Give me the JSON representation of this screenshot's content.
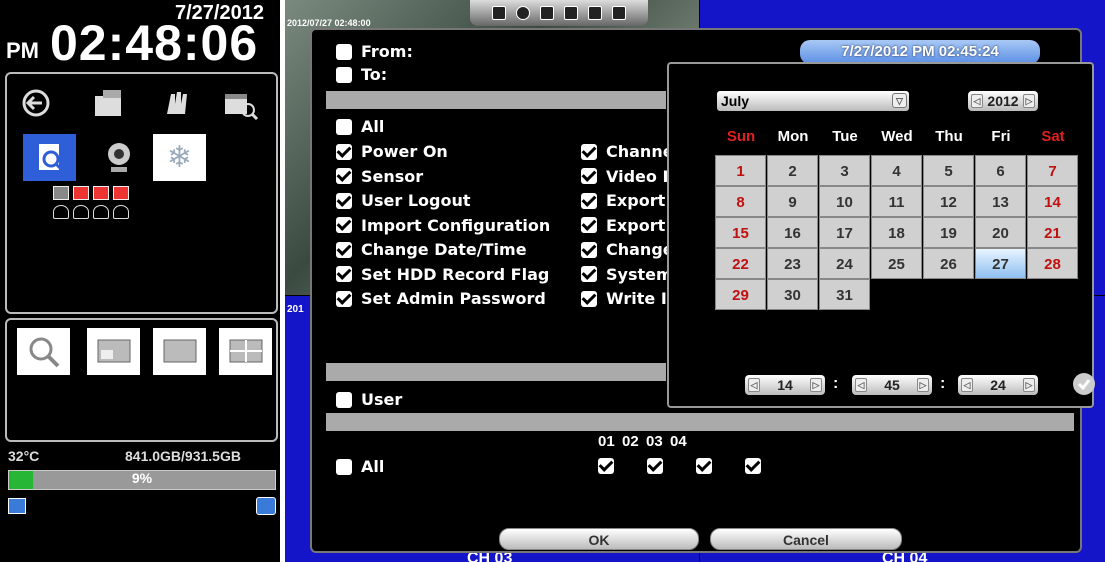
{
  "clock": {
    "date": "7/27/2012",
    "ampm": "PM",
    "time": "02:48:06"
  },
  "status": {
    "temperature": "32°C",
    "disk": "841.0GB/931.5GB",
    "usage_percent": 9,
    "usage_label": "9%"
  },
  "video": {
    "top_left_timestamp": "2012/07/27 02:48:00",
    "bottom_left_label": "201",
    "ch_bottom_left": "CH 03",
    "ch_bottom_right": "CH 04"
  },
  "dialog": {
    "from_label": "From:",
    "to_label": "To:",
    "from_value": "7/27/2012 PM 02:45:24",
    "all_label": "All",
    "events_left": [
      "Power On",
      "Sensor",
      "User Logout",
      "Import Configuration",
      "Change Date/Time",
      "Set HDD Record Flag",
      "Set Admin Password"
    ],
    "events_right": [
      "Channe",
      "Video I",
      "Export",
      "Export",
      "Change",
      "System",
      "Write I"
    ],
    "user_label": "User",
    "all2_label": "All",
    "channels": [
      "01",
      "02",
      "03",
      "04"
    ],
    "ok": "OK",
    "cancel": "Cancel"
  },
  "calendar": {
    "month": "July",
    "year": "2012",
    "weekdays": [
      "Sun",
      "Mon",
      "Tue",
      "Wed",
      "Thu",
      "Fri",
      "Sat"
    ],
    "selected_day": 27,
    "time": {
      "hour": "14",
      "minute": "45",
      "second": "24"
    }
  },
  "colors": {
    "accent": "#1414c8",
    "weekend": "#c01010",
    "progress": "#27b635"
  }
}
